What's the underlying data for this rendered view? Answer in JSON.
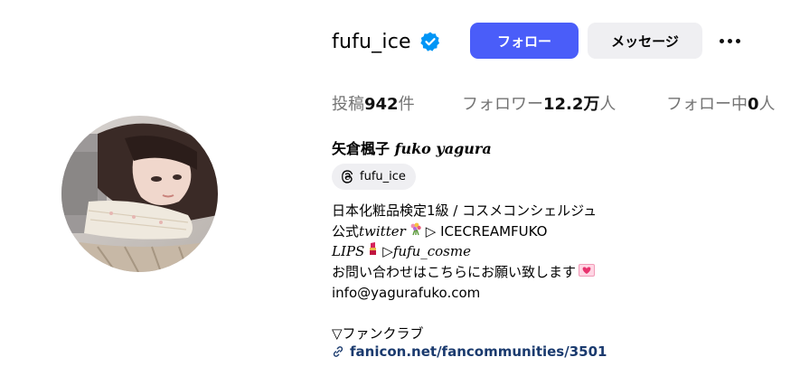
{
  "profile": {
    "username": "fufu_ice",
    "verified_icon": "verified-badge-icon",
    "follow_label": "フォロー",
    "message_label": "メッセージ",
    "more_icon": "more-options-icon"
  },
  "stats": {
    "posts_label": "投稿",
    "posts_count": "942",
    "posts_unit": "件",
    "followers_label": "フォロワー",
    "followers_count": "12.2万",
    "followers_unit": "人",
    "following_label": "フォロー中",
    "following_count": "0",
    "following_unit": "人"
  },
  "bio": {
    "fullname_jp": "矢倉楓子 ",
    "fullname_latin": "fuko yagura",
    "threads_handle": "fufu_ice",
    "threads_icon": "threads-icon",
    "line1": "日本化粧品検定1級 / コスメコンシェルジュ",
    "line2_prefix": "公式",
    "line2_italic": "twitter",
    "line2_suffix": "▷ ICECREAMFUKO",
    "line3_italic_a": "LIPS",
    "line3_mid": "▷",
    "line3_italic_b": "fufu_cosme",
    "line4": "お問い合わせはこちらにお願い致します",
    "line5": "info@yagurafuko.com",
    "line7": "▽ファンクラブ",
    "link_text": "fanicon.net/fancommunities/3501",
    "link_icon": "link-icon"
  },
  "colors": {
    "follow_button": "#4a5df9",
    "secondary_button": "#efeff2",
    "verified": "#0095f6",
    "link": "#1a3a6e"
  }
}
